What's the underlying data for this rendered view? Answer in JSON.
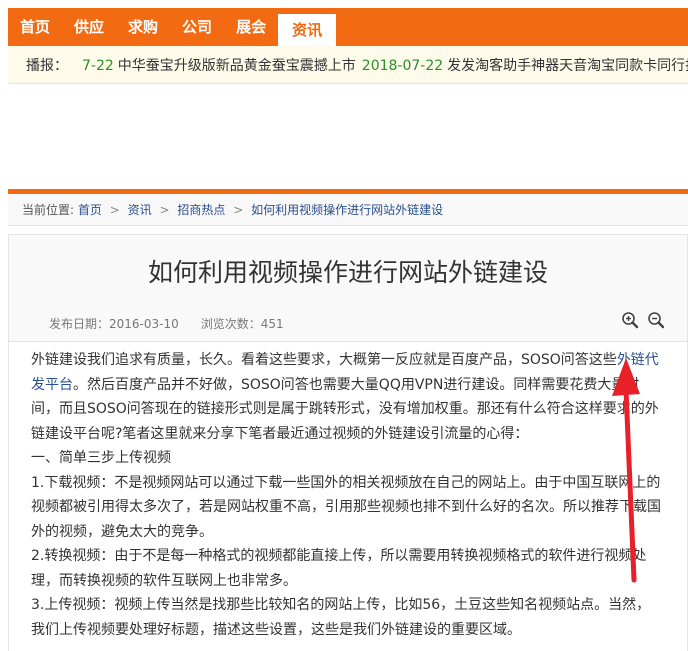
{
  "nav": {
    "items": [
      {
        "label": "首页"
      },
      {
        "label": "供应"
      },
      {
        "label": "求购"
      },
      {
        "label": "公司"
      },
      {
        "label": "展会"
      },
      {
        "label": "资讯",
        "active": true
      }
    ]
  },
  "ticker": {
    "label": "播报：",
    "items": [
      {
        "date": "7-22",
        "title": "中华蚕宝升级版新品黄金蚕宝震撼上市"
      },
      {
        "date": "2018-07-22",
        "title": "发发淘客助手神器天音淘宝同款卡同行批量"
      }
    ]
  },
  "breadcrumb": {
    "prefix": "当前位置:",
    "items": [
      "首页",
      "资讯",
      "招商热点",
      "如何利用视频操作进行网站外链建设"
    ],
    "separator": ">"
  },
  "article": {
    "title": "如何利用视频操作进行网站外链建设",
    "date_label": "发布日期：",
    "date": "2016-03-10",
    "views_label": "浏览次数：",
    "views": "451",
    "zoom_in_icon": "zoom-in-icon",
    "zoom_out_icon": "zoom-out-icon",
    "p1_before_link": "外链建设我们追求有质量，长久。看着这些要求，大概第一反应就是百度产品，SOSO问答这些",
    "p1_link": "外链代发平台",
    "p1_after_link": "。然后百度产品并不好做，SOSO问答也需要大量QQ用VPN进行建设。同样需要花费大量时间，而且SOSO问答现在的链接形式则是属于跳转形式，没有增加权重。那还有什么符合这样要求的外链建设平台呢?笔者这里就来分享下笔者最近通过视频的外链建设引流量的心得：",
    "p2": "一、简单三步上传视频",
    "p3": "1.下载视频：不是视频网站可以通过下载一些国外的相关视频放在自己的网站上。由于中国互联网上的视频都被引用得太多次了，若是网站权重不高，引用那些视频也排不到什么好的名次。所以推荐下载国外的视频，避免太大的竞争。",
    "p4": "2.转换视频：由于不是每一种格式的视频都能直接上传，所以需要用转换视频格式的软件进行视频处理，而转换视频的软件互联网上也非常多。",
    "p5": "3.上传视频：视频上传当然是找那些比较知名的网站上传，比如56，土豆这些知名视频站点。当然，我们上传视频要处理好标题，描述这些设置，这些是我们外链建设的重要区域。"
  },
  "colors": {
    "accent": "#f26b13",
    "link": "#2a4f8f",
    "date_green": "#2a8f2a",
    "arrow": "#e8202a"
  }
}
